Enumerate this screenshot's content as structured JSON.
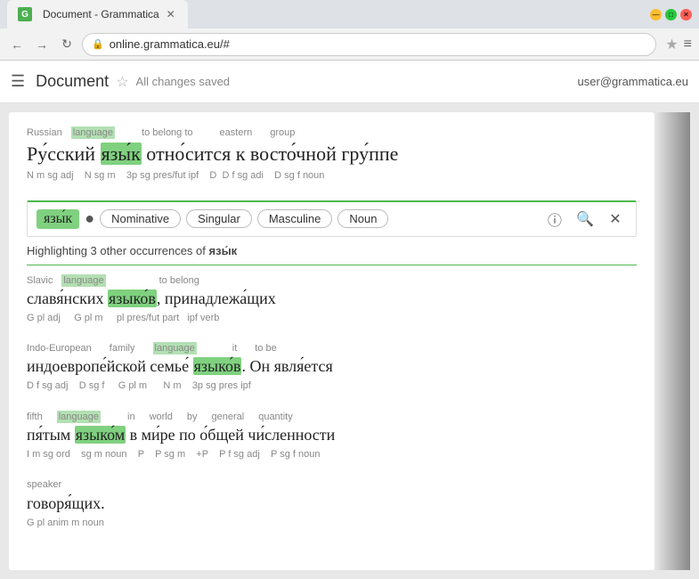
{
  "browser": {
    "title": "Document - Grammatica",
    "tab_icon": "G",
    "tab_label": "Document - Grammatica",
    "url": "online.grammatica.eu/#",
    "back_btn": "←",
    "forward_btn": "→",
    "reload_btn": "↻",
    "star_btn": "★",
    "menu_btn": "≡"
  },
  "appbar": {
    "menu_icon": "☰",
    "title": "Document",
    "star_icon": "☆",
    "saved_text": "All changes saved",
    "user_email": "user@grammatica.eu"
  },
  "word_bar": {
    "selected_word": "язы́к",
    "bullet": "●",
    "tags": [
      "Nominative",
      "Singular",
      "Masculine",
      "Noun"
    ],
    "info_icon": "ⓘ",
    "search_icon": "🔍",
    "close_icon": "✕"
  },
  "highlight_notice": {
    "text_before": "Highlighting 3 other occurrences of ",
    "highlighted_word": "язы́к"
  },
  "sentences": [
    {
      "id": "s1",
      "annotations_above": [
        {
          "text": "Russian",
          "pos": 0
        },
        {
          "text": "language",
          "pos": 1,
          "highlighted": true
        },
        {
          "text": "to belong to",
          "pos": 2
        },
        {
          "text": "eastern",
          "pos": 3
        },
        {
          "text": "group",
          "pos": 4
        }
      ],
      "text_parts": [
        {
          "text": "Ру́сский ",
          "highlight": false
        },
        {
          "text": "язы́к",
          "highlight": "selected"
        },
        {
          "text": " отно́сится к восто́чной гру́ппе",
          "highlight": false
        }
      ],
      "gram_below": "N m sg adj    N sg m    3p sg pres/fut ipf    D  D f sg adi    D sg f noun"
    },
    {
      "id": "s2",
      "annotations_above": [
        {
          "text": "Slavic",
          "pos": 0
        },
        {
          "text": "language",
          "pos": 1,
          "highlighted": true
        },
        {
          "text": "to belong",
          "pos": 2
        }
      ],
      "text_parts": [
        {
          "text": "славя́нских ",
          "highlight": false
        },
        {
          "text": "языко́в",
          "highlight": "green"
        },
        {
          "text": ", принадлежа́щих",
          "highlight": false
        }
      ],
      "gram_below": "G pl adj    G pl m    pl pres/fut part  ipf verb"
    },
    {
      "id": "s3",
      "annotations_above": [
        {
          "text": "Indo-European",
          "pos": 0
        },
        {
          "text": "family",
          "pos": 1
        },
        {
          "text": "language",
          "pos": 2,
          "highlighted": true
        },
        {
          "text": "it",
          "pos": 3
        },
        {
          "text": "to be",
          "pos": 4
        }
      ],
      "text_parts": [
        {
          "text": "индоевропе́йской семье́ ",
          "highlight": false
        },
        {
          "text": "языко́в",
          "highlight": "green"
        },
        {
          "text": ". Он явля́ется",
          "highlight": false
        }
      ],
      "gram_below": "D f sg adj    D sg f    G pl m    N m    3p sg pres ipf"
    },
    {
      "id": "s4",
      "annotations_above": [
        {
          "text": "fifth",
          "pos": 0
        },
        {
          "text": "language",
          "pos": 1,
          "highlighted": true
        },
        {
          "text": "in",
          "pos": 2
        },
        {
          "text": "world",
          "pos": 3
        },
        {
          "text": "by",
          "pos": 4
        },
        {
          "text": "general",
          "pos": 5
        },
        {
          "text": "quantity",
          "pos": 6
        }
      ],
      "text_parts": [
        {
          "text": "пя́тым ",
          "highlight": false
        },
        {
          "text": "языко́м",
          "highlight": "green"
        },
        {
          "text": " в ми́ре по о́бщей чи́сленности",
          "highlight": false
        }
      ],
      "gram_below": "I m sg ord    sg m noun    P    P sg m    +P    P f sg adj    P sg f noun"
    },
    {
      "id": "s5",
      "annotations_above": [
        {
          "text": "speaker",
          "pos": 0
        }
      ],
      "text_parts": [
        {
          "text": "говоря́щих.",
          "highlight": false
        }
      ],
      "gram_below": "G pl anim m noun"
    }
  ]
}
